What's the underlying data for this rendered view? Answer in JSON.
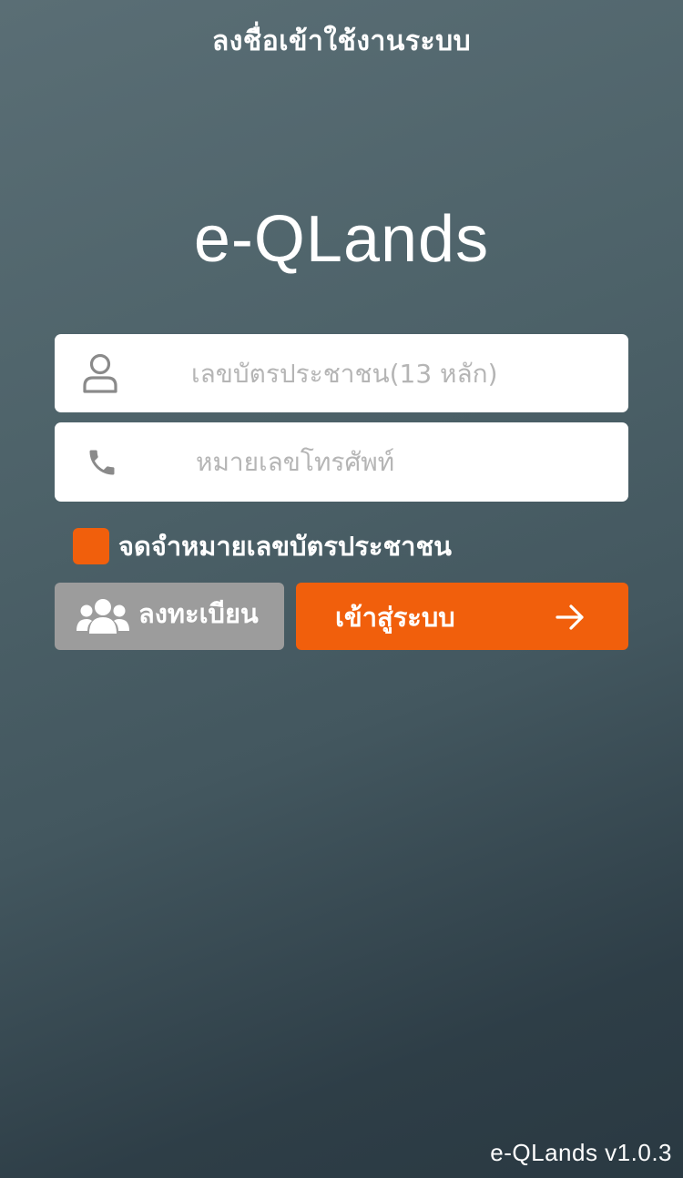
{
  "header": {
    "title": "ลงชื่อเข้าใช้งานระบบ"
  },
  "app": {
    "logo_text": "e-QLands",
    "version_text": "e-QLands v1.0.3"
  },
  "form": {
    "id_field": {
      "placeholder": "เลขบัตรประชาชน(13 หลัก)",
      "value": "",
      "icon": "user-icon"
    },
    "phone_field": {
      "placeholder": "หมายเลขโทรศัพท์",
      "value": "",
      "icon": "phone-icon"
    },
    "remember": {
      "label": "จดจำหมายเลขบัตรประชาชน",
      "checked": false
    }
  },
  "actions": {
    "register_label": "ลงทะเบียน",
    "register_icon": "users-icon",
    "login_label": "เข้าสู่ระบบ",
    "login_icon": "arrow-right-icon"
  },
  "colors": {
    "accent": "#f15f0c",
    "secondary_button": "#9c9c9c",
    "background_top": "#5a6e75",
    "background_bottom": "#2a3942",
    "icon_gray": "#8a8a8a",
    "placeholder": "#b5b5b5"
  }
}
